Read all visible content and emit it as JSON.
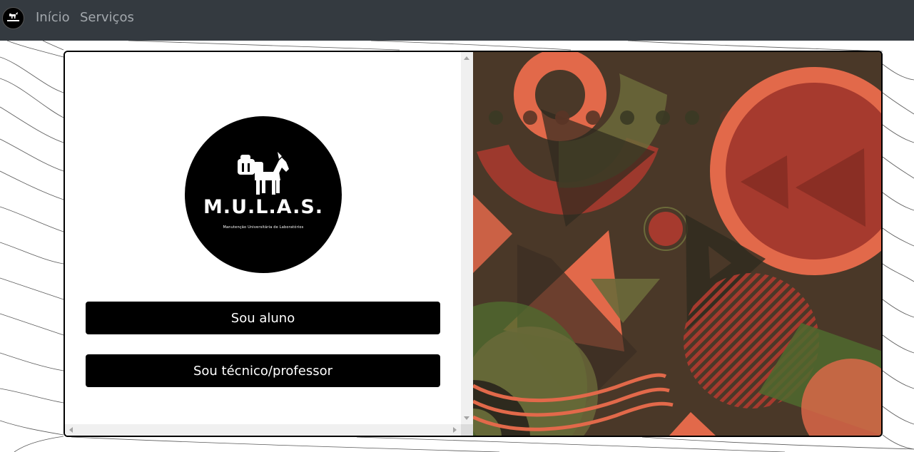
{
  "navbar": {
    "links": [
      {
        "label": "Início"
      },
      {
        "label": "Serviços"
      }
    ]
  },
  "logo": {
    "title": "M.U.L.A.S.",
    "subtitle": "Manutenção Universitária de Laboratórios"
  },
  "buttons": {
    "student": "Sou aluno",
    "staff": "Sou técnico/professor"
  },
  "colors": {
    "navbar": "#343a40",
    "button": "#000000",
    "art_background": "#4a3828",
    "art_orange": "#e2694a",
    "art_red": "#a63a2e",
    "art_olive": "#6b6a3a"
  }
}
